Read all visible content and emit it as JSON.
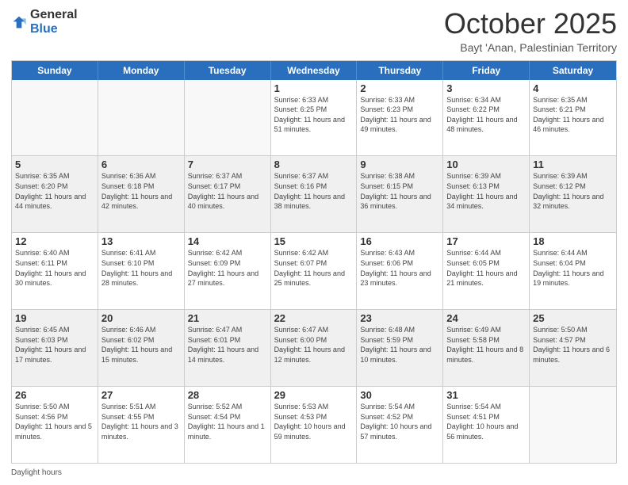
{
  "logo": {
    "general": "General",
    "blue": "Blue"
  },
  "title": "October 2025",
  "location": "Bayt 'Anan, Palestinian Territory",
  "weekdays": [
    "Sunday",
    "Monday",
    "Tuesday",
    "Wednesday",
    "Thursday",
    "Friday",
    "Saturday"
  ],
  "footer": "Daylight hours",
  "weeks": [
    [
      {
        "day": "",
        "info": ""
      },
      {
        "day": "",
        "info": ""
      },
      {
        "day": "",
        "info": ""
      },
      {
        "day": "1",
        "info": "Sunrise: 6:33 AM\nSunset: 6:25 PM\nDaylight: 11 hours\nand 51 minutes."
      },
      {
        "day": "2",
        "info": "Sunrise: 6:33 AM\nSunset: 6:23 PM\nDaylight: 11 hours\nand 49 minutes."
      },
      {
        "day": "3",
        "info": "Sunrise: 6:34 AM\nSunset: 6:22 PM\nDaylight: 11 hours\nand 48 minutes."
      },
      {
        "day": "4",
        "info": "Sunrise: 6:35 AM\nSunset: 6:21 PM\nDaylight: 11 hours\nand 46 minutes."
      }
    ],
    [
      {
        "day": "5",
        "info": "Sunrise: 6:35 AM\nSunset: 6:20 PM\nDaylight: 11 hours\nand 44 minutes."
      },
      {
        "day": "6",
        "info": "Sunrise: 6:36 AM\nSunset: 6:18 PM\nDaylight: 11 hours\nand 42 minutes."
      },
      {
        "day": "7",
        "info": "Sunrise: 6:37 AM\nSunset: 6:17 PM\nDaylight: 11 hours\nand 40 minutes."
      },
      {
        "day": "8",
        "info": "Sunrise: 6:37 AM\nSunset: 6:16 PM\nDaylight: 11 hours\nand 38 minutes."
      },
      {
        "day": "9",
        "info": "Sunrise: 6:38 AM\nSunset: 6:15 PM\nDaylight: 11 hours\nand 36 minutes."
      },
      {
        "day": "10",
        "info": "Sunrise: 6:39 AM\nSunset: 6:13 PM\nDaylight: 11 hours\nand 34 minutes."
      },
      {
        "day": "11",
        "info": "Sunrise: 6:39 AM\nSunset: 6:12 PM\nDaylight: 11 hours\nand 32 minutes."
      }
    ],
    [
      {
        "day": "12",
        "info": "Sunrise: 6:40 AM\nSunset: 6:11 PM\nDaylight: 11 hours\nand 30 minutes."
      },
      {
        "day": "13",
        "info": "Sunrise: 6:41 AM\nSunset: 6:10 PM\nDaylight: 11 hours\nand 28 minutes."
      },
      {
        "day": "14",
        "info": "Sunrise: 6:42 AM\nSunset: 6:09 PM\nDaylight: 11 hours\nand 27 minutes."
      },
      {
        "day": "15",
        "info": "Sunrise: 6:42 AM\nSunset: 6:07 PM\nDaylight: 11 hours\nand 25 minutes."
      },
      {
        "day": "16",
        "info": "Sunrise: 6:43 AM\nSunset: 6:06 PM\nDaylight: 11 hours\nand 23 minutes."
      },
      {
        "day": "17",
        "info": "Sunrise: 6:44 AM\nSunset: 6:05 PM\nDaylight: 11 hours\nand 21 minutes."
      },
      {
        "day": "18",
        "info": "Sunrise: 6:44 AM\nSunset: 6:04 PM\nDaylight: 11 hours\nand 19 minutes."
      }
    ],
    [
      {
        "day": "19",
        "info": "Sunrise: 6:45 AM\nSunset: 6:03 PM\nDaylight: 11 hours\nand 17 minutes."
      },
      {
        "day": "20",
        "info": "Sunrise: 6:46 AM\nSunset: 6:02 PM\nDaylight: 11 hours\nand 15 minutes."
      },
      {
        "day": "21",
        "info": "Sunrise: 6:47 AM\nSunset: 6:01 PM\nDaylight: 11 hours\nand 14 minutes."
      },
      {
        "day": "22",
        "info": "Sunrise: 6:47 AM\nSunset: 6:00 PM\nDaylight: 11 hours\nand 12 minutes."
      },
      {
        "day": "23",
        "info": "Sunrise: 6:48 AM\nSunset: 5:59 PM\nDaylight: 11 hours\nand 10 minutes."
      },
      {
        "day": "24",
        "info": "Sunrise: 6:49 AM\nSunset: 5:58 PM\nDaylight: 11 hours\nand 8 minutes."
      },
      {
        "day": "25",
        "info": "Sunrise: 5:50 AM\nSunset: 4:57 PM\nDaylight: 11 hours\nand 6 minutes."
      }
    ],
    [
      {
        "day": "26",
        "info": "Sunrise: 5:50 AM\nSunset: 4:56 PM\nDaylight: 11 hours\nand 5 minutes."
      },
      {
        "day": "27",
        "info": "Sunrise: 5:51 AM\nSunset: 4:55 PM\nDaylight: 11 hours\nand 3 minutes."
      },
      {
        "day": "28",
        "info": "Sunrise: 5:52 AM\nSunset: 4:54 PM\nDaylight: 11 hours\nand 1 minute."
      },
      {
        "day": "29",
        "info": "Sunrise: 5:53 AM\nSunset: 4:53 PM\nDaylight: 10 hours\nand 59 minutes."
      },
      {
        "day": "30",
        "info": "Sunrise: 5:54 AM\nSunset: 4:52 PM\nDaylight: 10 hours\nand 57 minutes."
      },
      {
        "day": "31",
        "info": "Sunrise: 5:54 AM\nSunset: 4:51 PM\nDaylight: 10 hours\nand 56 minutes."
      },
      {
        "day": "",
        "info": ""
      }
    ]
  ]
}
